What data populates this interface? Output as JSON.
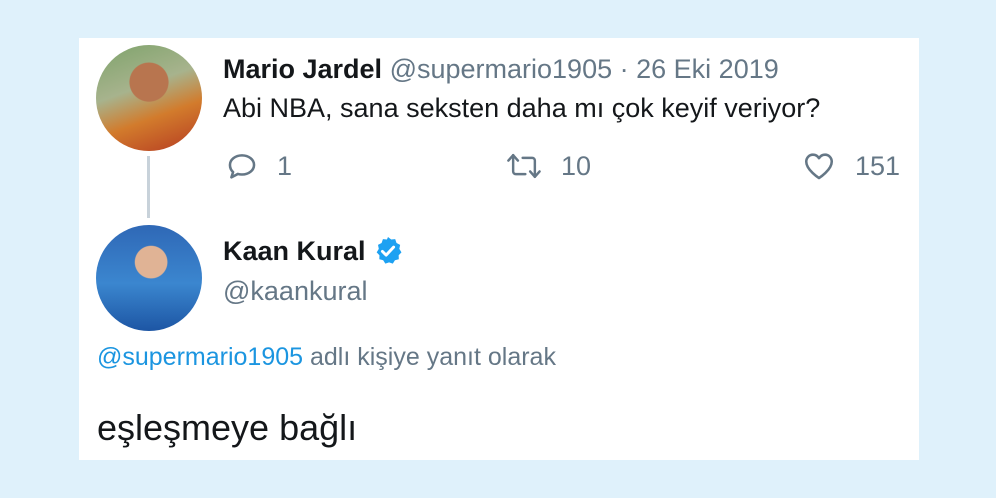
{
  "tweet1": {
    "author_name": "Mario Jardel",
    "handle": "@supermario1905",
    "separator": "·",
    "date": "26 Eki 2019",
    "text": "Abi NBA, sana seksten daha mı çok keyif veriyor?",
    "replies": "1",
    "retweets": "10",
    "likes": "151"
  },
  "tweet2": {
    "author_name": "Kaan Kural",
    "handle": "@kaankural",
    "reply_to_handle": "@supermario1905",
    "reply_to_suffix": "adlı kişiye yanıt olarak",
    "text": "eşleşmeye bağlı"
  },
  "colors": {
    "background": "#dff1fb",
    "card": "#ffffff",
    "text": "#14171a",
    "muted": "#657786",
    "link": "#1b95e0",
    "verified": "#1da1f2"
  },
  "icons": {
    "reply": "reply-icon",
    "retweet": "retweet-icon",
    "like": "heart-icon",
    "verified": "verified-badge-icon"
  }
}
